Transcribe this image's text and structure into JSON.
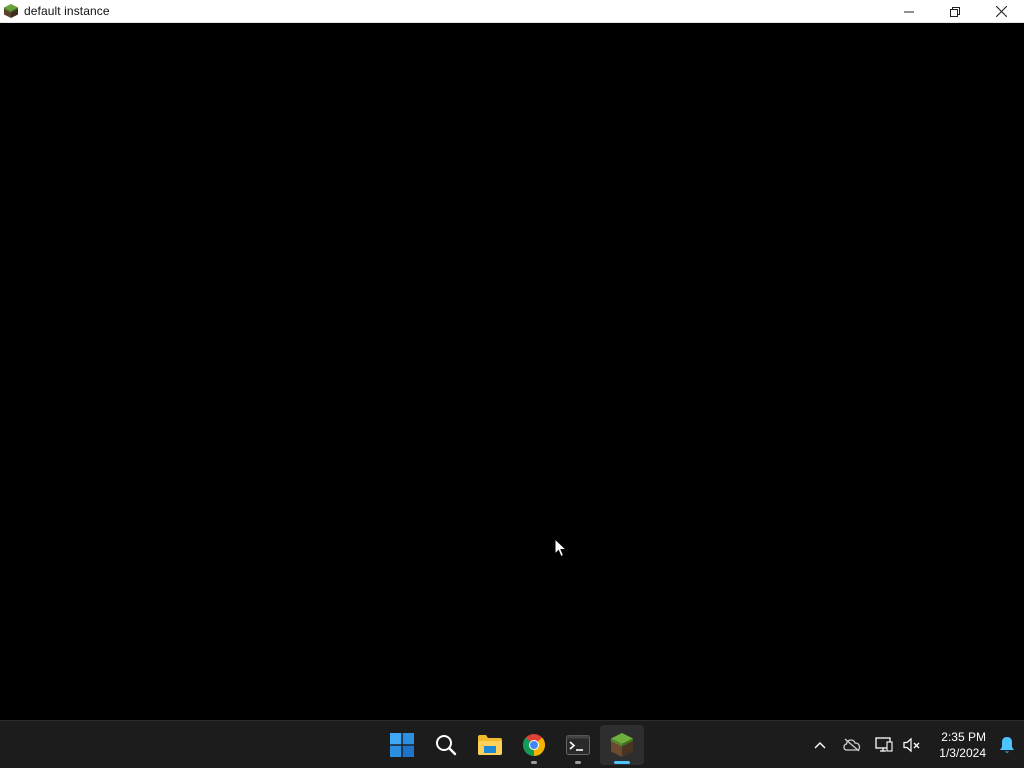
{
  "window": {
    "title": "default instance",
    "app_icon": "grass-block-icon",
    "controls": [
      "minimize-icon",
      "restore-icon",
      "close-icon"
    ]
  },
  "taskbar": {
    "apps": [
      {
        "name": "Start",
        "icon": "windows-start-icon",
        "running": false,
        "active": false
      },
      {
        "name": "Search",
        "icon": "search-icon",
        "running": false,
        "active": false
      },
      {
        "name": "File Explorer",
        "icon": "folder-icon",
        "running": false,
        "active": false
      },
      {
        "name": "Google Chrome",
        "icon": "chrome-icon",
        "running": true,
        "active": false
      },
      {
        "name": "Terminal",
        "icon": "terminal-icon",
        "running": true,
        "active": false
      },
      {
        "name": "Minecraft",
        "icon": "grass-block-icon",
        "running": true,
        "active": true
      }
    ],
    "tray": {
      "icons": [
        "chevron-up-icon",
        "cloud-off-icon",
        "network-icon",
        "volume-muted-icon"
      ],
      "time": "2:35 PM",
      "date": "1/3/2024",
      "notification_icon": "bell-icon"
    }
  },
  "colors": {
    "accent": "#4cc2ff",
    "taskbar_bg": "#1c1c1c",
    "viewport_bg": "#000000"
  }
}
